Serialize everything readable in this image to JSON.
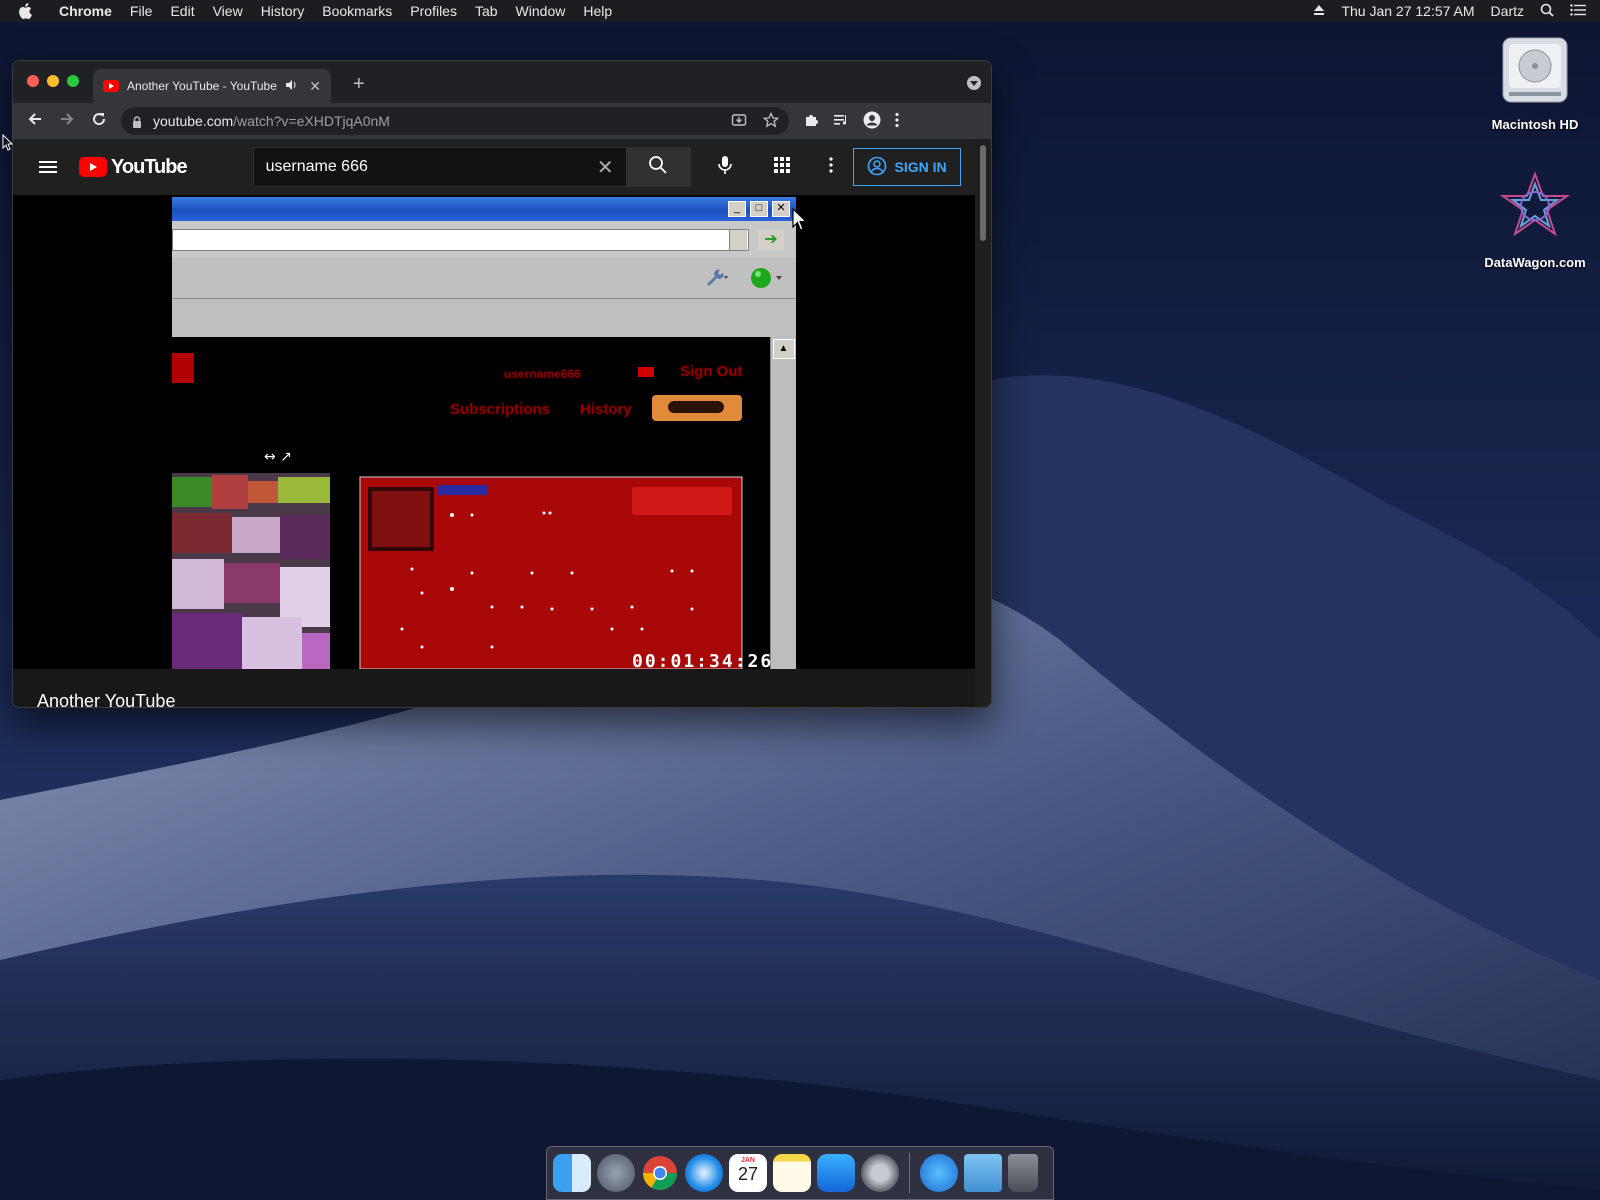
{
  "menubar": {
    "app_name": "Chrome",
    "items": [
      "File",
      "Edit",
      "View",
      "History",
      "Bookmarks",
      "Profiles",
      "Tab",
      "Window",
      "Help"
    ],
    "clock": "Thu Jan 27  12:57 AM",
    "user": "Dartz"
  },
  "desktop": {
    "icons": [
      {
        "label": "Macintosh HD",
        "icon": "hard-drive-icon"
      },
      {
        "label": "DataWagon.com",
        "icon": "datawagon-icon"
      }
    ]
  },
  "browser": {
    "tab": {
      "title": "Another YouTube - YouTube"
    },
    "address": {
      "host": "youtube.com",
      "path": "/watch?v=eXHDTjqA0nM"
    }
  },
  "youtube": {
    "search_value": "username 666",
    "sign_in_label": "SIGN IN",
    "video_title": "Another YouTube",
    "timecode": "00:01:34:26",
    "logo_text": "YouTube"
  },
  "video_frame": {
    "glitch_texts": [
      "username666",
      "Sign Out",
      "Subscriptions",
      "History"
    ]
  },
  "dock": {
    "apps": [
      "finder-icon",
      "launchpad-icon",
      "chrome-icon",
      "safari-icon",
      "calendar-icon",
      "notes-icon",
      "app-store-icon",
      "system-preferences-icon",
      "app-store-downloads-icon",
      "downloads-folder-icon",
      "trash-icon"
    ],
    "calendar_month": "JAN",
    "calendar_day": "27"
  },
  "colors": {
    "youtube_red": "#ff0000",
    "signin_blue": "#3ea6ff",
    "chrome_dark": "#202124"
  }
}
